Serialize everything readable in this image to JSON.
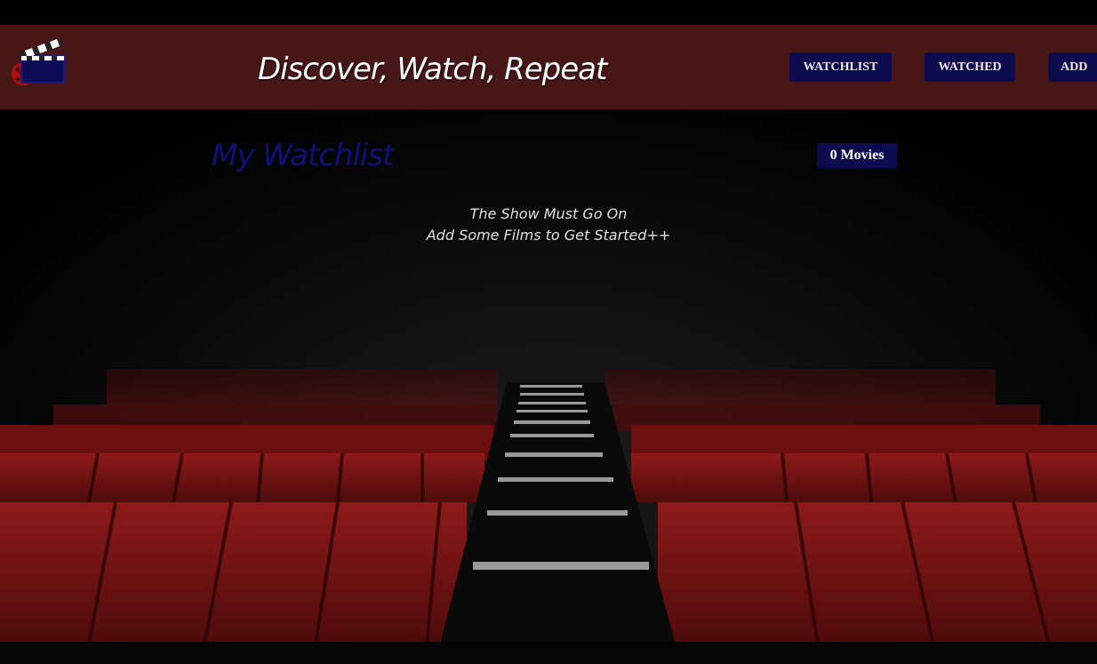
{
  "header": {
    "tagline": "Discover, Watch, Repeat",
    "nav": {
      "watchlist_label": "WATCHLIST",
      "watched_label": "WATCHED",
      "add_label": "ADD"
    },
    "logo_icon": "film-clapperboard-icon"
  },
  "main": {
    "title": "My Watchlist",
    "count_label": "0 Movies",
    "empty_state": {
      "line1": "The Show Must Go On",
      "line2": "Add Some Films to Get Started++"
    }
  },
  "colors": {
    "header_bg": "#471616",
    "button_bg": "#0b0b4d",
    "title_color": "#10107a",
    "seat_red": "#7a1414"
  }
}
